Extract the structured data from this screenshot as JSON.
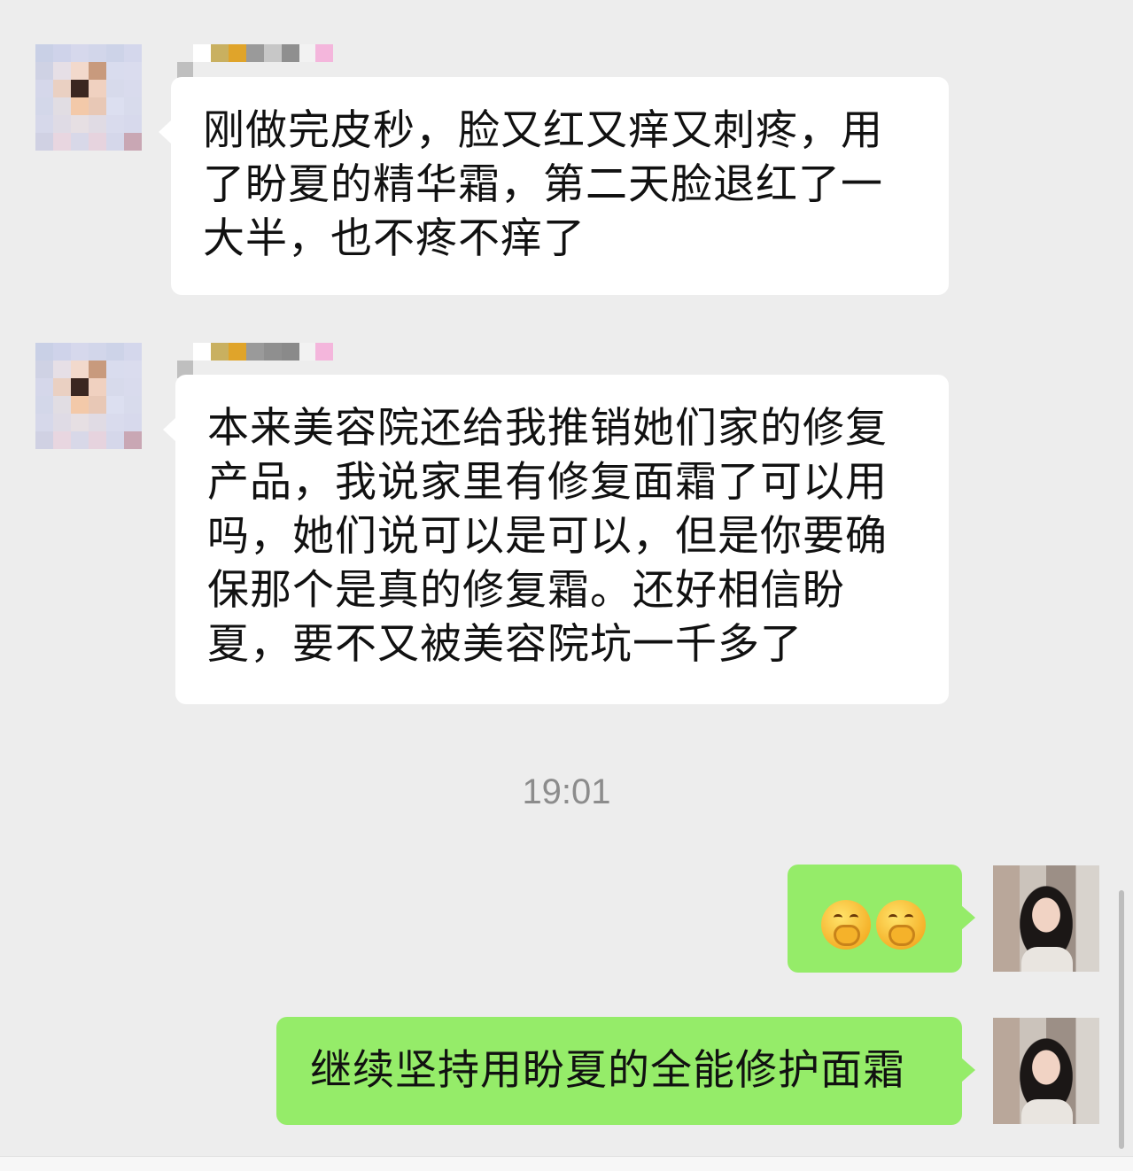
{
  "chat": {
    "messages": [
      {
        "side": "incoming",
        "text": "刚做完皮秒，脸又红又痒又刺疼，用了盼夏的精华霜，第二天脸退红了一大半，也不疼不痒了",
        "lines": [
          "刚做完皮秒，脸又红又痒又刺疼，用",
          "了盼夏的精华霜，第二天脸退红了一",
          "大半，也不疼不痒了"
        ]
      },
      {
        "side": "incoming",
        "text": "本来美容院还给我推销她们家的修复产品，我说家里有修复面霜了可以用吗，她们说可以是可以，但是你要确保那个是真的修复霜。还好相信盼夏，要不又被美容院坑一千多了",
        "lines": [
          "本来美容院还给我推销她们家的修复",
          "产品，我说家里有修复面霜了可以用",
          "吗，她们说可以是可以，但是你要确",
          "保那个是真的修复霜。还好相信盼",
          "夏，要不又被美容院坑一千多了"
        ]
      },
      {
        "side": "outgoing",
        "emoji": [
          "face-with-hand-over-mouth-emoji",
          "face-with-hand-over-mouth-emoji"
        ]
      },
      {
        "side": "outgoing",
        "text": "继续坚持用盼夏的全能修护面霜"
      }
    ],
    "timestamp": "19:01"
  },
  "colors": {
    "background": "#ededed",
    "incoming_bubble": "#ffffff",
    "outgoing_bubble": "#95ec69",
    "timestamp": "#8c8c8c"
  }
}
